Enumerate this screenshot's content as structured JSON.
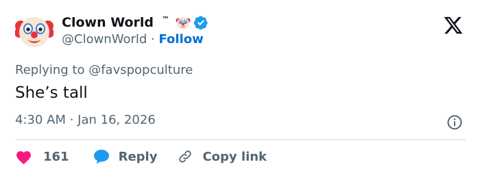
{
  "tweet": {
    "author": {
      "display_name": "Clown World",
      "trademark": "™",
      "handle": "@ClownWorld",
      "separator": " · ",
      "follow_label": "Follow",
      "avatar_icon": "clown-face-icon",
      "badge_icon": "verified-badge-icon"
    },
    "replying_to_prefix": "Replying to ",
    "replying_to_handle": "@favspopculture",
    "text": "She’s tall",
    "timestamp": "4:30 AM · Jan 16, 2026",
    "actions": {
      "like_count": "161",
      "reply_label": "Reply",
      "copy_link_label": "Copy link"
    }
  },
  "colors": {
    "text_primary": "#0f1419",
    "text_secondary": "#536471",
    "follow_blue": "#006fd6",
    "verified_blue": "#1d9bf0",
    "like_pink": "#f91880",
    "reply_blue": "#1d9bf0",
    "divider": "#cfd9de"
  }
}
